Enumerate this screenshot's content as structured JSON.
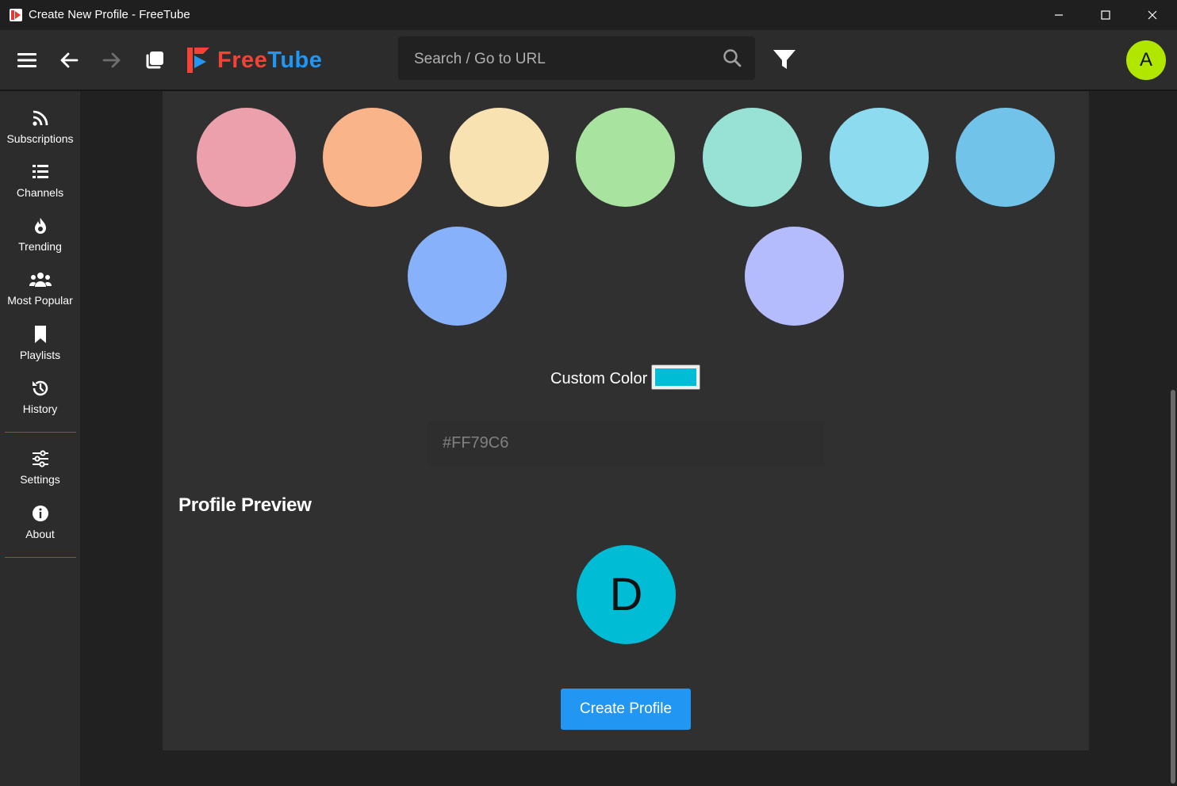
{
  "window": {
    "title": "Create New Profile - FreeTube"
  },
  "brand": {
    "free": "Free",
    "tube": "Tube"
  },
  "search": {
    "placeholder": "Search / Go to URL"
  },
  "profile_avatar": {
    "letter": "A",
    "color": "#b0e600"
  },
  "sidebar": {
    "items": [
      {
        "label": "Subscriptions",
        "icon": "rss-icon"
      },
      {
        "label": "Channels",
        "icon": "list-icon"
      },
      {
        "label": "Trending",
        "icon": "fire-icon"
      },
      {
        "label": "Most Popular",
        "icon": "users-icon"
      },
      {
        "label": "Playlists",
        "icon": "bookmark-icon"
      },
      {
        "label": "History",
        "icon": "history-icon"
      },
      {
        "label": "Settings",
        "icon": "sliders-icon"
      },
      {
        "label": "About",
        "icon": "info-icon"
      }
    ]
  },
  "colors": {
    "swatches": [
      "#eca0ab",
      "#f9b489",
      "#f9e2b2",
      "#a8e3a0",
      "#97e2d5",
      "#8cdbee",
      "#72c3ea",
      "#87b2fb",
      "#b4bcfe"
    ],
    "accent": "#2196f3",
    "separator": "#d32f2f"
  },
  "editor": {
    "custom_color_label": "Custom Color",
    "custom_color_value": "#00bcd4",
    "hex_placeholder": "#FF79C6",
    "preview_title": "Profile Preview",
    "preview_letter": "D",
    "preview_color": "#00bcd4",
    "create_button": "Create Profile"
  }
}
